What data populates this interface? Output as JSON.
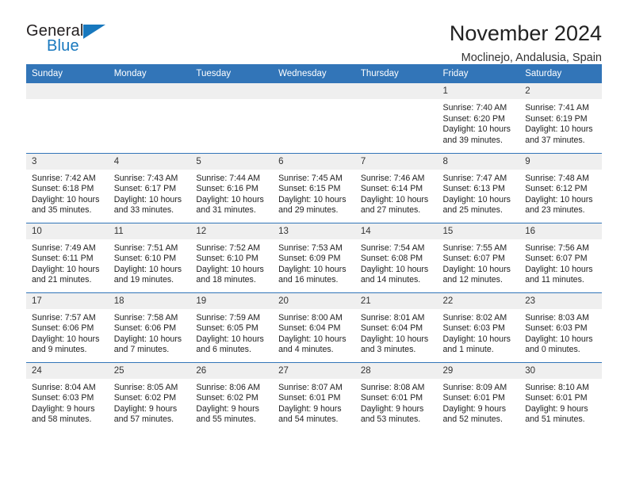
{
  "brand": {
    "name_top": "General",
    "name_bottom": "Blue",
    "triangle_color": "#1878be"
  },
  "header": {
    "title": "November 2024",
    "subtitle": "Moclinejo, Andalusia, Spain",
    "accent_color": "#3275b8",
    "daynum_band_color": "#efefef"
  },
  "weekdays": [
    "Sunday",
    "Monday",
    "Tuesday",
    "Wednesday",
    "Thursday",
    "Friday",
    "Saturday"
  ],
  "weeks": [
    [
      {
        "day": "",
        "empty": true,
        "sunrise": "",
        "sunset": "",
        "daylight": "",
        "daylight2": ""
      },
      {
        "day": "",
        "empty": true,
        "sunrise": "",
        "sunset": "",
        "daylight": "",
        "daylight2": ""
      },
      {
        "day": "",
        "empty": true,
        "sunrise": "",
        "sunset": "",
        "daylight": "",
        "daylight2": ""
      },
      {
        "day": "",
        "empty": true,
        "sunrise": "",
        "sunset": "",
        "daylight": "",
        "daylight2": ""
      },
      {
        "day": "",
        "empty": true,
        "sunrise": "",
        "sunset": "",
        "daylight": "",
        "daylight2": ""
      },
      {
        "day": "1",
        "empty": false,
        "sunrise": "Sunrise: 7:40 AM",
        "sunset": "Sunset: 6:20 PM",
        "daylight": "Daylight: 10 hours",
        "daylight2": "and 39 minutes."
      },
      {
        "day": "2",
        "empty": false,
        "sunrise": "Sunrise: 7:41 AM",
        "sunset": "Sunset: 6:19 PM",
        "daylight": "Daylight: 10 hours",
        "daylight2": "and 37 minutes."
      }
    ],
    [
      {
        "day": "3",
        "empty": false,
        "sunrise": "Sunrise: 7:42 AM",
        "sunset": "Sunset: 6:18 PM",
        "daylight": "Daylight: 10 hours",
        "daylight2": "and 35 minutes."
      },
      {
        "day": "4",
        "empty": false,
        "sunrise": "Sunrise: 7:43 AM",
        "sunset": "Sunset: 6:17 PM",
        "daylight": "Daylight: 10 hours",
        "daylight2": "and 33 minutes."
      },
      {
        "day": "5",
        "empty": false,
        "sunrise": "Sunrise: 7:44 AM",
        "sunset": "Sunset: 6:16 PM",
        "daylight": "Daylight: 10 hours",
        "daylight2": "and 31 minutes."
      },
      {
        "day": "6",
        "empty": false,
        "sunrise": "Sunrise: 7:45 AM",
        "sunset": "Sunset: 6:15 PM",
        "daylight": "Daylight: 10 hours",
        "daylight2": "and 29 minutes."
      },
      {
        "day": "7",
        "empty": false,
        "sunrise": "Sunrise: 7:46 AM",
        "sunset": "Sunset: 6:14 PM",
        "daylight": "Daylight: 10 hours",
        "daylight2": "and 27 minutes."
      },
      {
        "day": "8",
        "empty": false,
        "sunrise": "Sunrise: 7:47 AM",
        "sunset": "Sunset: 6:13 PM",
        "daylight": "Daylight: 10 hours",
        "daylight2": "and 25 minutes."
      },
      {
        "day": "9",
        "empty": false,
        "sunrise": "Sunrise: 7:48 AM",
        "sunset": "Sunset: 6:12 PM",
        "daylight": "Daylight: 10 hours",
        "daylight2": "and 23 minutes."
      }
    ],
    [
      {
        "day": "10",
        "empty": false,
        "sunrise": "Sunrise: 7:49 AM",
        "sunset": "Sunset: 6:11 PM",
        "daylight": "Daylight: 10 hours",
        "daylight2": "and 21 minutes."
      },
      {
        "day": "11",
        "empty": false,
        "sunrise": "Sunrise: 7:51 AM",
        "sunset": "Sunset: 6:10 PM",
        "daylight": "Daylight: 10 hours",
        "daylight2": "and 19 minutes."
      },
      {
        "day": "12",
        "empty": false,
        "sunrise": "Sunrise: 7:52 AM",
        "sunset": "Sunset: 6:10 PM",
        "daylight": "Daylight: 10 hours",
        "daylight2": "and 18 minutes."
      },
      {
        "day": "13",
        "empty": false,
        "sunrise": "Sunrise: 7:53 AM",
        "sunset": "Sunset: 6:09 PM",
        "daylight": "Daylight: 10 hours",
        "daylight2": "and 16 minutes."
      },
      {
        "day": "14",
        "empty": false,
        "sunrise": "Sunrise: 7:54 AM",
        "sunset": "Sunset: 6:08 PM",
        "daylight": "Daylight: 10 hours",
        "daylight2": "and 14 minutes."
      },
      {
        "day": "15",
        "empty": false,
        "sunrise": "Sunrise: 7:55 AM",
        "sunset": "Sunset: 6:07 PM",
        "daylight": "Daylight: 10 hours",
        "daylight2": "and 12 minutes."
      },
      {
        "day": "16",
        "empty": false,
        "sunrise": "Sunrise: 7:56 AM",
        "sunset": "Sunset: 6:07 PM",
        "daylight": "Daylight: 10 hours",
        "daylight2": "and 11 minutes."
      }
    ],
    [
      {
        "day": "17",
        "empty": false,
        "sunrise": "Sunrise: 7:57 AM",
        "sunset": "Sunset: 6:06 PM",
        "daylight": "Daylight: 10 hours",
        "daylight2": "and 9 minutes."
      },
      {
        "day": "18",
        "empty": false,
        "sunrise": "Sunrise: 7:58 AM",
        "sunset": "Sunset: 6:06 PM",
        "daylight": "Daylight: 10 hours",
        "daylight2": "and 7 minutes."
      },
      {
        "day": "19",
        "empty": false,
        "sunrise": "Sunrise: 7:59 AM",
        "sunset": "Sunset: 6:05 PM",
        "daylight": "Daylight: 10 hours",
        "daylight2": "and 6 minutes."
      },
      {
        "day": "20",
        "empty": false,
        "sunrise": "Sunrise: 8:00 AM",
        "sunset": "Sunset: 6:04 PM",
        "daylight": "Daylight: 10 hours",
        "daylight2": "and 4 minutes."
      },
      {
        "day": "21",
        "empty": false,
        "sunrise": "Sunrise: 8:01 AM",
        "sunset": "Sunset: 6:04 PM",
        "daylight": "Daylight: 10 hours",
        "daylight2": "and 3 minutes."
      },
      {
        "day": "22",
        "empty": false,
        "sunrise": "Sunrise: 8:02 AM",
        "sunset": "Sunset: 6:03 PM",
        "daylight": "Daylight: 10 hours",
        "daylight2": "and 1 minute."
      },
      {
        "day": "23",
        "empty": false,
        "sunrise": "Sunrise: 8:03 AM",
        "sunset": "Sunset: 6:03 PM",
        "daylight": "Daylight: 10 hours",
        "daylight2": "and 0 minutes."
      }
    ],
    [
      {
        "day": "24",
        "empty": false,
        "sunrise": "Sunrise: 8:04 AM",
        "sunset": "Sunset: 6:03 PM",
        "daylight": "Daylight: 9 hours",
        "daylight2": "and 58 minutes."
      },
      {
        "day": "25",
        "empty": false,
        "sunrise": "Sunrise: 8:05 AM",
        "sunset": "Sunset: 6:02 PM",
        "daylight": "Daylight: 9 hours",
        "daylight2": "and 57 minutes."
      },
      {
        "day": "26",
        "empty": false,
        "sunrise": "Sunrise: 8:06 AM",
        "sunset": "Sunset: 6:02 PM",
        "daylight": "Daylight: 9 hours",
        "daylight2": "and 55 minutes."
      },
      {
        "day": "27",
        "empty": false,
        "sunrise": "Sunrise: 8:07 AM",
        "sunset": "Sunset: 6:01 PM",
        "daylight": "Daylight: 9 hours",
        "daylight2": "and 54 minutes."
      },
      {
        "day": "28",
        "empty": false,
        "sunrise": "Sunrise: 8:08 AM",
        "sunset": "Sunset: 6:01 PM",
        "daylight": "Daylight: 9 hours",
        "daylight2": "and 53 minutes."
      },
      {
        "day": "29",
        "empty": false,
        "sunrise": "Sunrise: 8:09 AM",
        "sunset": "Sunset: 6:01 PM",
        "daylight": "Daylight: 9 hours",
        "daylight2": "and 52 minutes."
      },
      {
        "day": "30",
        "empty": false,
        "sunrise": "Sunrise: 8:10 AM",
        "sunset": "Sunset: 6:01 PM",
        "daylight": "Daylight: 9 hours",
        "daylight2": "and 51 minutes."
      }
    ]
  ]
}
